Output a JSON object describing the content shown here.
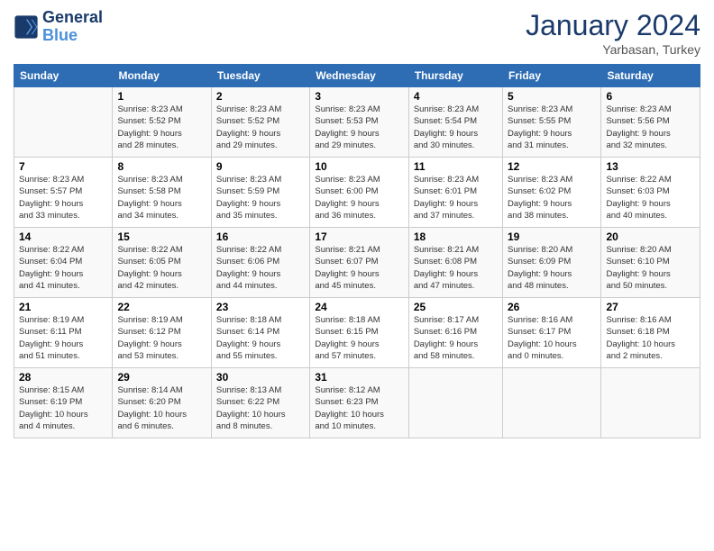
{
  "logo": {
    "line1": "General",
    "line2": "Blue"
  },
  "title": "January 2024",
  "subtitle": "Yarbasan, Turkey",
  "days_header": [
    "Sunday",
    "Monday",
    "Tuesday",
    "Wednesday",
    "Thursday",
    "Friday",
    "Saturday"
  ],
  "weeks": [
    [
      {
        "num": "",
        "info": ""
      },
      {
        "num": "1",
        "info": "Sunrise: 8:23 AM\nSunset: 5:52 PM\nDaylight: 9 hours\nand 28 minutes."
      },
      {
        "num": "2",
        "info": "Sunrise: 8:23 AM\nSunset: 5:52 PM\nDaylight: 9 hours\nand 29 minutes."
      },
      {
        "num": "3",
        "info": "Sunrise: 8:23 AM\nSunset: 5:53 PM\nDaylight: 9 hours\nand 29 minutes."
      },
      {
        "num": "4",
        "info": "Sunrise: 8:23 AM\nSunset: 5:54 PM\nDaylight: 9 hours\nand 30 minutes."
      },
      {
        "num": "5",
        "info": "Sunrise: 8:23 AM\nSunset: 5:55 PM\nDaylight: 9 hours\nand 31 minutes."
      },
      {
        "num": "6",
        "info": "Sunrise: 8:23 AM\nSunset: 5:56 PM\nDaylight: 9 hours\nand 32 minutes."
      }
    ],
    [
      {
        "num": "7",
        "info": "Sunrise: 8:23 AM\nSunset: 5:57 PM\nDaylight: 9 hours\nand 33 minutes."
      },
      {
        "num": "8",
        "info": "Sunrise: 8:23 AM\nSunset: 5:58 PM\nDaylight: 9 hours\nand 34 minutes."
      },
      {
        "num": "9",
        "info": "Sunrise: 8:23 AM\nSunset: 5:59 PM\nDaylight: 9 hours\nand 35 minutes."
      },
      {
        "num": "10",
        "info": "Sunrise: 8:23 AM\nSunset: 6:00 PM\nDaylight: 9 hours\nand 36 minutes."
      },
      {
        "num": "11",
        "info": "Sunrise: 8:23 AM\nSunset: 6:01 PM\nDaylight: 9 hours\nand 37 minutes."
      },
      {
        "num": "12",
        "info": "Sunrise: 8:23 AM\nSunset: 6:02 PM\nDaylight: 9 hours\nand 38 minutes."
      },
      {
        "num": "13",
        "info": "Sunrise: 8:22 AM\nSunset: 6:03 PM\nDaylight: 9 hours\nand 40 minutes."
      }
    ],
    [
      {
        "num": "14",
        "info": "Sunrise: 8:22 AM\nSunset: 6:04 PM\nDaylight: 9 hours\nand 41 minutes."
      },
      {
        "num": "15",
        "info": "Sunrise: 8:22 AM\nSunset: 6:05 PM\nDaylight: 9 hours\nand 42 minutes."
      },
      {
        "num": "16",
        "info": "Sunrise: 8:22 AM\nSunset: 6:06 PM\nDaylight: 9 hours\nand 44 minutes."
      },
      {
        "num": "17",
        "info": "Sunrise: 8:21 AM\nSunset: 6:07 PM\nDaylight: 9 hours\nand 45 minutes."
      },
      {
        "num": "18",
        "info": "Sunrise: 8:21 AM\nSunset: 6:08 PM\nDaylight: 9 hours\nand 47 minutes."
      },
      {
        "num": "19",
        "info": "Sunrise: 8:20 AM\nSunset: 6:09 PM\nDaylight: 9 hours\nand 48 minutes."
      },
      {
        "num": "20",
        "info": "Sunrise: 8:20 AM\nSunset: 6:10 PM\nDaylight: 9 hours\nand 50 minutes."
      }
    ],
    [
      {
        "num": "21",
        "info": "Sunrise: 8:19 AM\nSunset: 6:11 PM\nDaylight: 9 hours\nand 51 minutes."
      },
      {
        "num": "22",
        "info": "Sunrise: 8:19 AM\nSunset: 6:12 PM\nDaylight: 9 hours\nand 53 minutes."
      },
      {
        "num": "23",
        "info": "Sunrise: 8:18 AM\nSunset: 6:14 PM\nDaylight: 9 hours\nand 55 minutes."
      },
      {
        "num": "24",
        "info": "Sunrise: 8:18 AM\nSunset: 6:15 PM\nDaylight: 9 hours\nand 57 minutes."
      },
      {
        "num": "25",
        "info": "Sunrise: 8:17 AM\nSunset: 6:16 PM\nDaylight: 9 hours\nand 58 minutes."
      },
      {
        "num": "26",
        "info": "Sunrise: 8:16 AM\nSunset: 6:17 PM\nDaylight: 10 hours\nand 0 minutes."
      },
      {
        "num": "27",
        "info": "Sunrise: 8:16 AM\nSunset: 6:18 PM\nDaylight: 10 hours\nand 2 minutes."
      }
    ],
    [
      {
        "num": "28",
        "info": "Sunrise: 8:15 AM\nSunset: 6:19 PM\nDaylight: 10 hours\nand 4 minutes."
      },
      {
        "num": "29",
        "info": "Sunrise: 8:14 AM\nSunset: 6:20 PM\nDaylight: 10 hours\nand 6 minutes."
      },
      {
        "num": "30",
        "info": "Sunrise: 8:13 AM\nSunset: 6:22 PM\nDaylight: 10 hours\nand 8 minutes."
      },
      {
        "num": "31",
        "info": "Sunrise: 8:12 AM\nSunset: 6:23 PM\nDaylight: 10 hours\nand 10 minutes."
      },
      {
        "num": "",
        "info": ""
      },
      {
        "num": "",
        "info": ""
      },
      {
        "num": "",
        "info": ""
      }
    ]
  ]
}
